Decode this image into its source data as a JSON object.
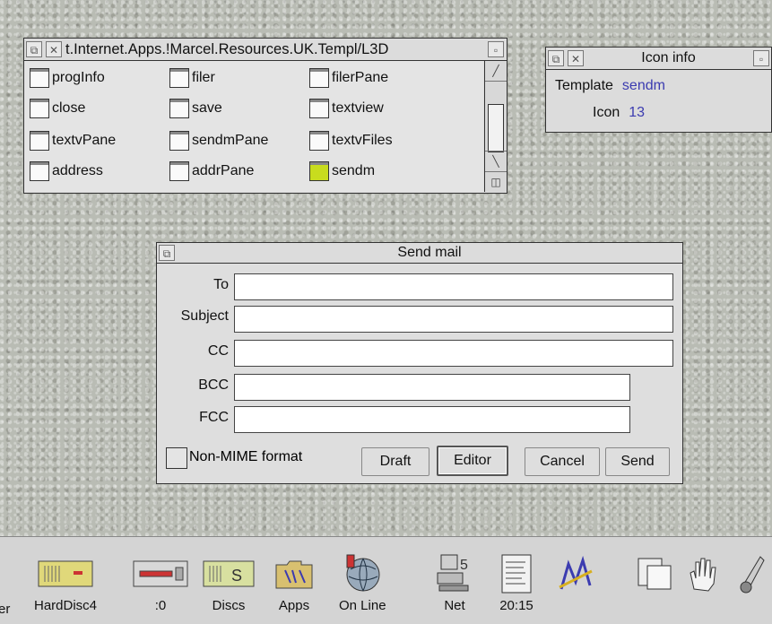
{
  "template_window": {
    "title": "t.Internet.Apps.!Marcel.Resources.UK.Templ/L3D",
    "items": [
      {
        "label": "progInfo",
        "selected": false
      },
      {
        "label": "filer",
        "selected": false
      },
      {
        "label": "filerPane",
        "selected": false
      },
      {
        "label": "close",
        "selected": false
      },
      {
        "label": "save",
        "selected": false
      },
      {
        "label": "textview",
        "selected": false
      },
      {
        "label": "textvPane",
        "selected": false
      },
      {
        "label": "sendmPane",
        "selected": false
      },
      {
        "label": "textvFiles",
        "selected": false
      },
      {
        "label": "address",
        "selected": false
      },
      {
        "label": "addrPane",
        "selected": false
      },
      {
        "label": "sendm",
        "selected": true
      }
    ]
  },
  "icon_info": {
    "title": "Icon info",
    "template_label": "Template",
    "template_value": "sendm",
    "icon_label": "Icon",
    "icon_value": "13"
  },
  "send_mail": {
    "title": "Send mail",
    "fields": {
      "to": {
        "label": "To",
        "value": ""
      },
      "subject": {
        "label": "Subject",
        "value": ""
      },
      "cc": {
        "label": "CC",
        "value": ""
      },
      "bcc": {
        "label": "BCC",
        "value": ""
      },
      "fcc": {
        "label": "FCC",
        "value": ""
      }
    },
    "non_mime_label": "Non-MIME format",
    "buttons": {
      "draft": "Draft",
      "editor": "Editor",
      "cancel": "Cancel",
      "send": "Send"
    }
  },
  "iconbar": {
    "items": [
      "er",
      "HardDisc4",
      ":0",
      "Discs",
      "Apps",
      "On Line",
      "Net",
      "20:15"
    ]
  },
  "colors": {
    "highlight": "#c8dc1e",
    "info_value": "#3b3bb0"
  }
}
